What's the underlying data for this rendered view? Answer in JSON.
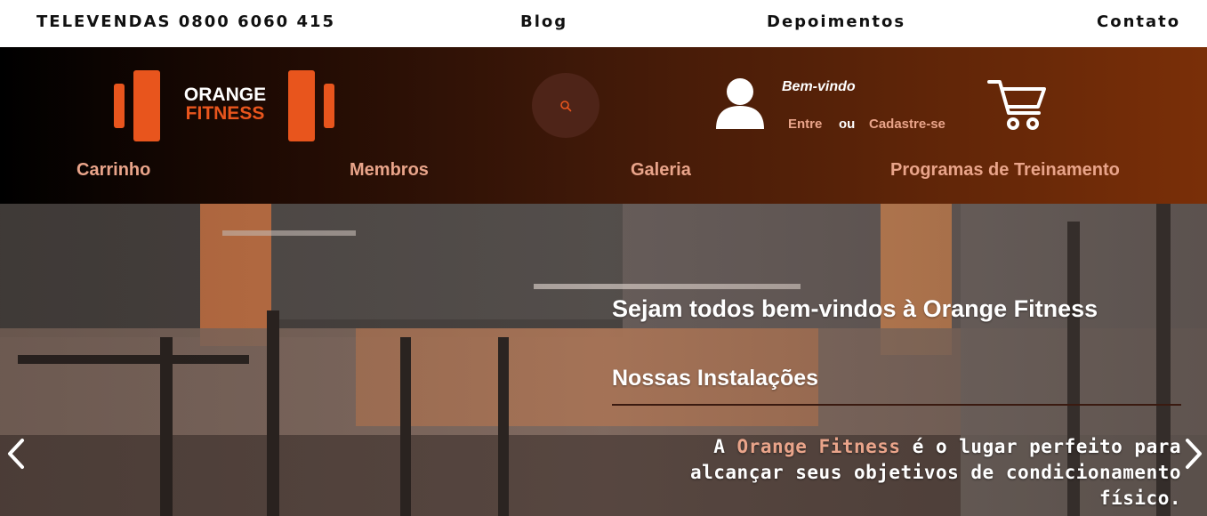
{
  "topbar": {
    "phone": "TELEVENDAS 0800 6060 415",
    "blog": "Blog",
    "testimonials": "Depoimentos",
    "contact": "Contato"
  },
  "header": {
    "logo": {
      "line1": "ORANGE",
      "line2": "FITNESS"
    },
    "search_icon": "search-icon",
    "user": {
      "welcome": "Bem-vindo",
      "login": "Entre",
      "or": "ou",
      "register": "Cadastre-se"
    },
    "cart_icon": "cart-icon",
    "nav": [
      "Carrinho",
      "Membros",
      "Galeria",
      "Programas de Treinamento"
    ]
  },
  "hero": {
    "title": "Sejam todos bem-vindos à Orange Fitness",
    "subtitle": "Nossas Instalações",
    "desc_prefix": "A ",
    "desc_brand": "Orange Fitness",
    "desc_rest": " é o lugar perfeito para alcançar seus objetivos de condicionamento físico."
  },
  "colors": {
    "brand_orange": "#e8551d",
    "link_pink": "#e9a48a",
    "header_dark": "#000000",
    "header_rust": "#7a2f08"
  }
}
